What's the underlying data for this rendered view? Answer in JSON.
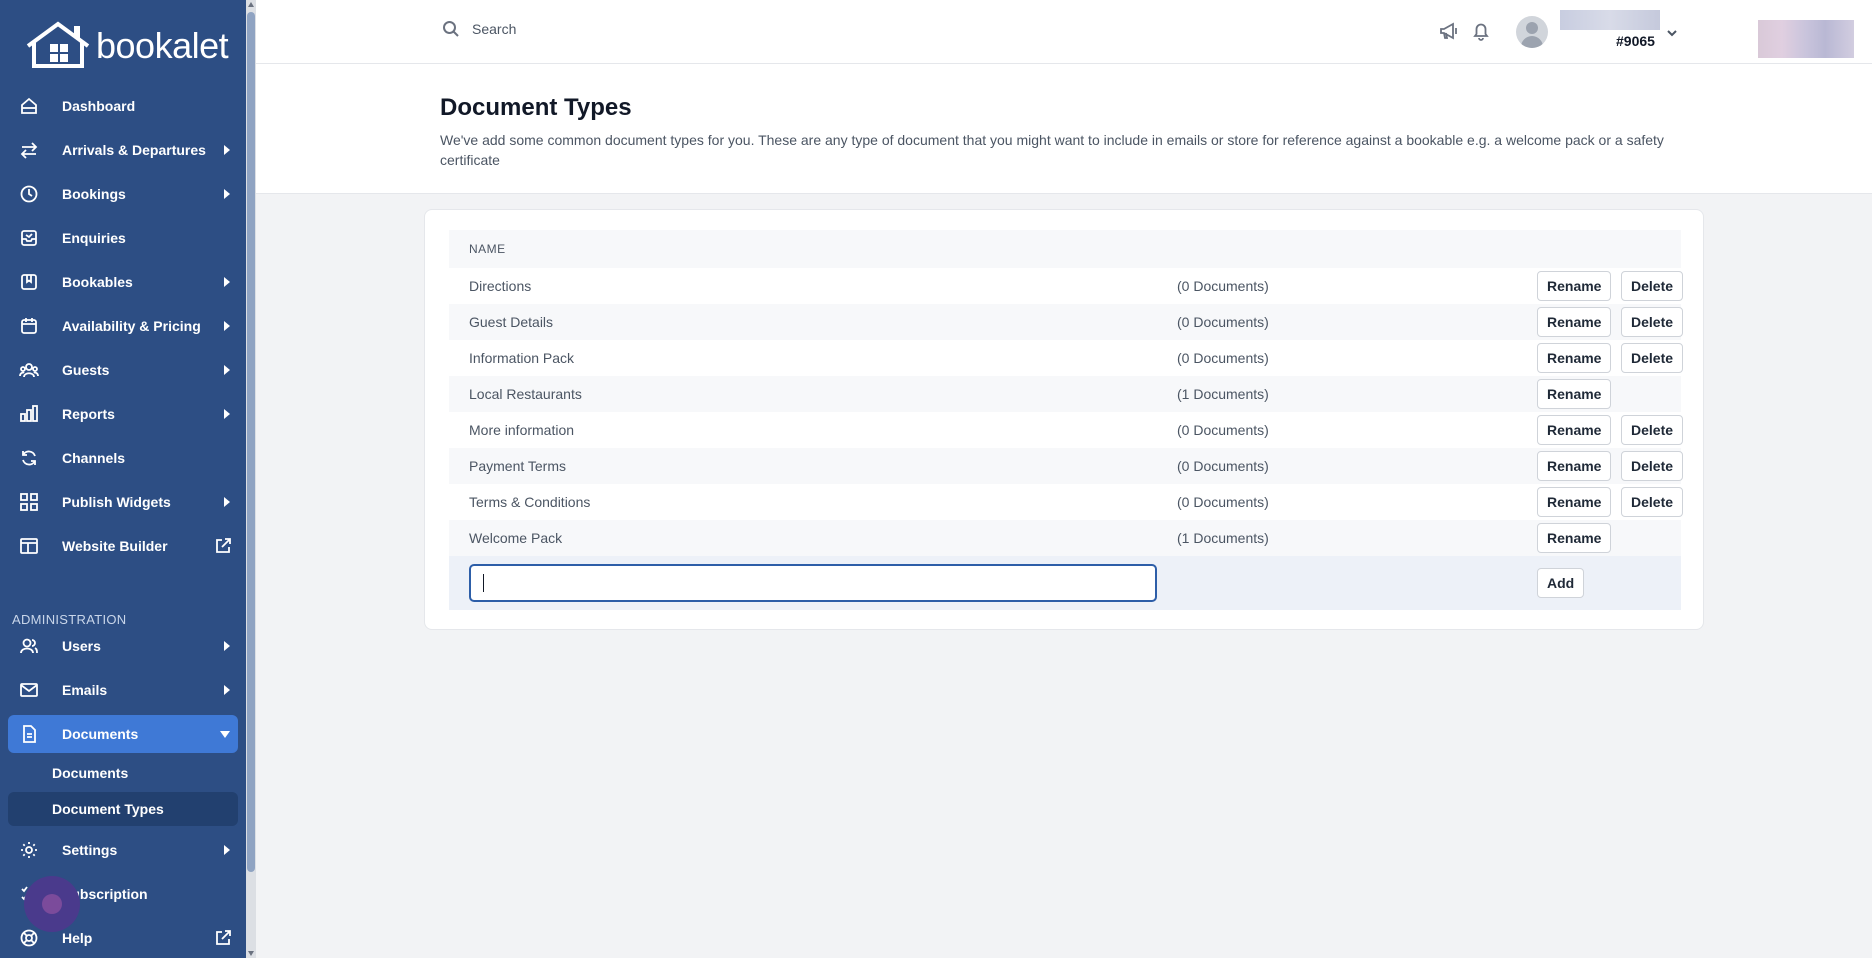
{
  "sidebar": {
    "brand": "bookalet",
    "items": [
      {
        "label": "Dashboard"
      },
      {
        "label": "Arrivals & Departures"
      },
      {
        "label": "Bookings"
      },
      {
        "label": "Enquiries"
      },
      {
        "label": "Bookables"
      },
      {
        "label": "Availability & Pricing"
      },
      {
        "label": "Guests"
      },
      {
        "label": "Reports"
      },
      {
        "label": "Channels"
      },
      {
        "label": "Publish Widgets"
      },
      {
        "label": "Website Builder"
      }
    ],
    "admin_label": "ADMINISTRATION",
    "admin_items": [
      {
        "label": "Users"
      },
      {
        "label": "Emails"
      },
      {
        "label": "Documents"
      }
    ],
    "documents_sub": [
      {
        "label": "Documents"
      },
      {
        "label": "Document Types"
      }
    ],
    "bottom_items": [
      {
        "label": "Settings"
      },
      {
        "label": "Subscription"
      },
      {
        "label": "Help"
      }
    ]
  },
  "topbar": {
    "search_placeholder": "Search",
    "user_id": "#9065"
  },
  "page": {
    "title": "Document Types",
    "description": "We've add some common document types for you. These are any type of document that you might want to include in emails or store for reference against a bookable e.g. a welcome pack or a safety certificate"
  },
  "table": {
    "header_name": "NAME",
    "rename_label": "Rename",
    "delete_label": "Delete",
    "add_label": "Add",
    "rows": [
      {
        "name": "Directions",
        "count": "(0 Documents)"
      },
      {
        "name": "Guest Details",
        "count": "(0 Documents)"
      },
      {
        "name": "Information Pack",
        "count": "(0 Documents)"
      },
      {
        "name": "Local Restaurants",
        "count": "(1 Documents)"
      },
      {
        "name": "More information",
        "count": "(0 Documents)"
      },
      {
        "name": "Payment Terms",
        "count": "(0 Documents)"
      },
      {
        "name": "Terms & Conditions",
        "count": "(0 Documents)"
      },
      {
        "name": "Welcome Pack",
        "count": "(1 Documents)"
      }
    ],
    "new_type_value": ""
  }
}
